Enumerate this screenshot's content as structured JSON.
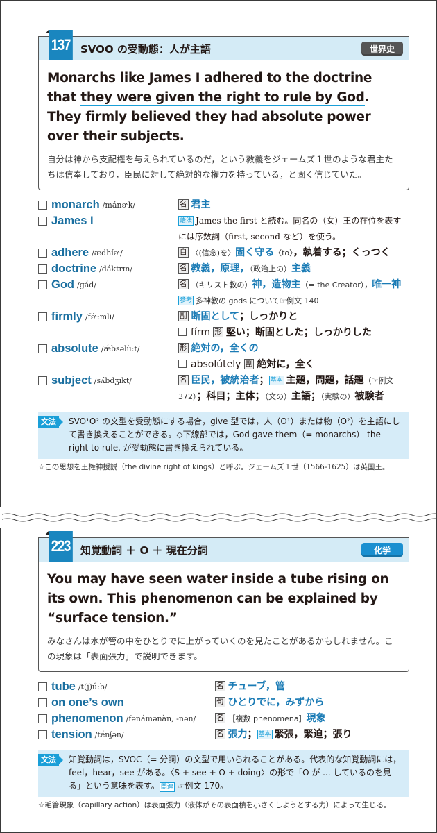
{
  "colors": {
    "accent_blue": "#1a86bf",
    "word_blue": "#1a6fa0",
    "head_bg": "#d4ebf6",
    "grammar_bg": "#d6ecf8",
    "badge_history": "#555555",
    "badge_chemistry": "#1a8fd0"
  },
  "examples": [
    {
      "number": "137",
      "title": "SVOO の受動態：人が主語",
      "subject_badge": "世界史",
      "sentence_parts": [
        {
          "text": "Monarchs like James I adhered to the doctrine that ",
          "underline": false
        },
        {
          "text": "they were given the right to rule by God",
          "underline": true
        },
        {
          "text": ".  They firmly believed they had absolute power over their subjects.",
          "underline": false
        }
      ],
      "translation": "自分は神から支配権を与えられているのだ，という教義をジェームズ１世のような君主たちは信奉しており，臣民に対して絶対的な権力を持っている，と固く信じていた。",
      "vocab": [
        {
          "word": "monarch",
          "pron": "/mánɚk/",
          "pos": "名",
          "meaning_html_parts": [
            {
              "t": "君主",
              "c": "blue"
            }
          ]
        },
        {
          "word": "James I",
          "pron": "",
          "tag": "語法",
          "meaning_html_parts": [
            {
              "t": "James the first と読む。同名の（女）王の在位を表すには序数詞（first, second など）を使う。",
              "c": "serif"
            }
          ]
        },
        {
          "word": "adhere",
          "pron": "/ædhíɚ/",
          "pos": "自",
          "meaning_html_parts": [
            {
              "t": "〈(信念)を〉",
              "c": "small"
            },
            {
              "t": "固く守る",
              "c": "blue"
            },
            {
              "t": "〈to〉",
              "c": "small"
            },
            {
              "t": "，執着する；くっつく",
              "c": "bold"
            }
          ]
        },
        {
          "word": "doctrine",
          "pron": "/dáktrɪn/",
          "pos": "名",
          "meaning_html_parts": [
            {
              "t": "教義，原理，",
              "c": "blue"
            },
            {
              "t": "（政治上の）",
              "c": "small"
            },
            {
              "t": "主義",
              "c": "blue"
            }
          ]
        },
        {
          "word": "God",
          "pron": "/gád/",
          "pos": "名",
          "meaning_html_parts": [
            {
              "t": "（キリスト教の）",
              "c": "small"
            },
            {
              "t": "神，造物主",
              "c": "blue"
            },
            {
              "t": "（= the Creator），",
              "c": "small"
            },
            {
              "t": "唯一神",
              "c": "blue"
            },
            {
              "t": "　",
              "c": ""
            },
            {
              "t": "参考",
              "c": "tag"
            },
            {
              "t": "多神教の gods について☞例文 140",
              "c": "small"
            }
          ]
        },
        {
          "word": "firmly",
          "pron": "/fɚ́:mli/",
          "pos": "副",
          "meaning_html_parts": [
            {
              "t": "断固として",
              "c": "blue"
            },
            {
              "t": "；しっかりと",
              "c": "bold"
            }
          ],
          "derived": {
            "word": "fírm",
            "pos": "形",
            "meaning": "堅い；断固とした；しっかりした"
          }
        },
        {
          "word": "absolute",
          "pron": "/ǽbsəlù:t/",
          "pos": "形",
          "meaning_html_parts": [
            {
              "t": "絶対の，全くの",
              "c": "blue"
            }
          ],
          "derived": {
            "word": "absolútely",
            "pos": "副",
            "meaning": "絶対に，全く"
          }
        },
        {
          "word": "subject",
          "pron": "/sʌ́bdʒɪkt/",
          "pos": "名",
          "meaning_html_parts": [
            {
              "t": "臣民，被統治者",
              "c": "blue"
            },
            {
              "t": "；",
              "c": "bold"
            },
            {
              "t": "基本",
              "c": "tag"
            },
            {
              "t": "主題，問題，話題",
              "c": "bold"
            },
            {
              "t": "（☞例文 372）",
              "c": "small"
            },
            {
              "t": "；科目；主体；",
              "c": "bold"
            },
            {
              "t": "（文の）",
              "c": "small"
            },
            {
              "t": "主語；",
              "c": "bold"
            },
            {
              "t": "（実験の）",
              "c": "small"
            },
            {
              "t": "被験者",
              "c": "bold"
            }
          ]
        }
      ],
      "grammar_label": "文法",
      "grammar_note": "SVO¹O² の文型を受動態にする場合，give 型では，人（O¹）または物（O²）を主語にして書き換えることができる。◇下線部では，God gave them（= monarchs） the right to rule. が受動態に書き換えられている。",
      "footnote": "☆この思想を王権神授説（the divine right of kings）と呼ぶ。ジェームズ１世（1566-1625）は英国王。"
    },
    {
      "number": "223",
      "title": "知覚動詞 ＋ O ＋ 現在分詞",
      "subject_badge": "化学",
      "sentence_parts": [
        {
          "text": "You may have ",
          "underline": false
        },
        {
          "text": "seen",
          "underline": true
        },
        {
          "text": " water inside a tube ",
          "underline": false
        },
        {
          "text": "rising",
          "underline": true
        },
        {
          "text": " on its own.  This phenomenon can be explained by “surface tension.”",
          "underline": false
        }
      ],
      "translation": "みなさんは水が管の中をひとりでに上がっていくのを見たことがあるかもしれません。この現象は「表面張力」で説明できます。",
      "vocab": [
        {
          "word": "tube",
          "pron": "/t(j)ú:b/",
          "pos": "名",
          "meaning_html_parts": [
            {
              "t": "チューブ，管",
              "c": "blue"
            }
          ]
        },
        {
          "word": "on one’s own",
          "pron": "",
          "pos": "句",
          "meaning_html_parts": [
            {
              "t": "ひとりでに，みずから",
              "c": "blue"
            }
          ]
        },
        {
          "word": "phenomenon",
          "pron": "/fənámənàn, -nən/",
          "pos": "名",
          "meaning_html_parts": [
            {
              "t": "［複数 phenomena］",
              "c": "small"
            },
            {
              "t": "現象",
              "c": "blue"
            }
          ]
        },
        {
          "word": "tension",
          "pron": "/ténʃən/",
          "pos": "名",
          "meaning_html_parts": [
            {
              "t": "張力",
              "c": "blue"
            },
            {
              "t": "；",
              "c": "bold"
            },
            {
              "t": "基本",
              "c": "tag"
            },
            {
              "t": "緊張，緊迫；張り",
              "c": "bold"
            }
          ]
        }
      ],
      "grammar_label": "文法",
      "grammar_note_parts": [
        {
          "t": "知覚動詞は，SVOC（= 分詞）の文型で用いられることがある。代表的な知覚動詞には，feel，hear，see がある。〈S + see + O + doing〉の形で「O が ... しているのを見る」という意味を表す。",
          "c": ""
        },
        {
          "t": "関連",
          "c": "ref"
        },
        {
          "t": " ☞例文 170。",
          "c": ""
        }
      ],
      "footnote": "☆毛管現象（capillary action）は表面張力（液体がその表面積を小さくしようとする力）によって生じる。"
    }
  ]
}
